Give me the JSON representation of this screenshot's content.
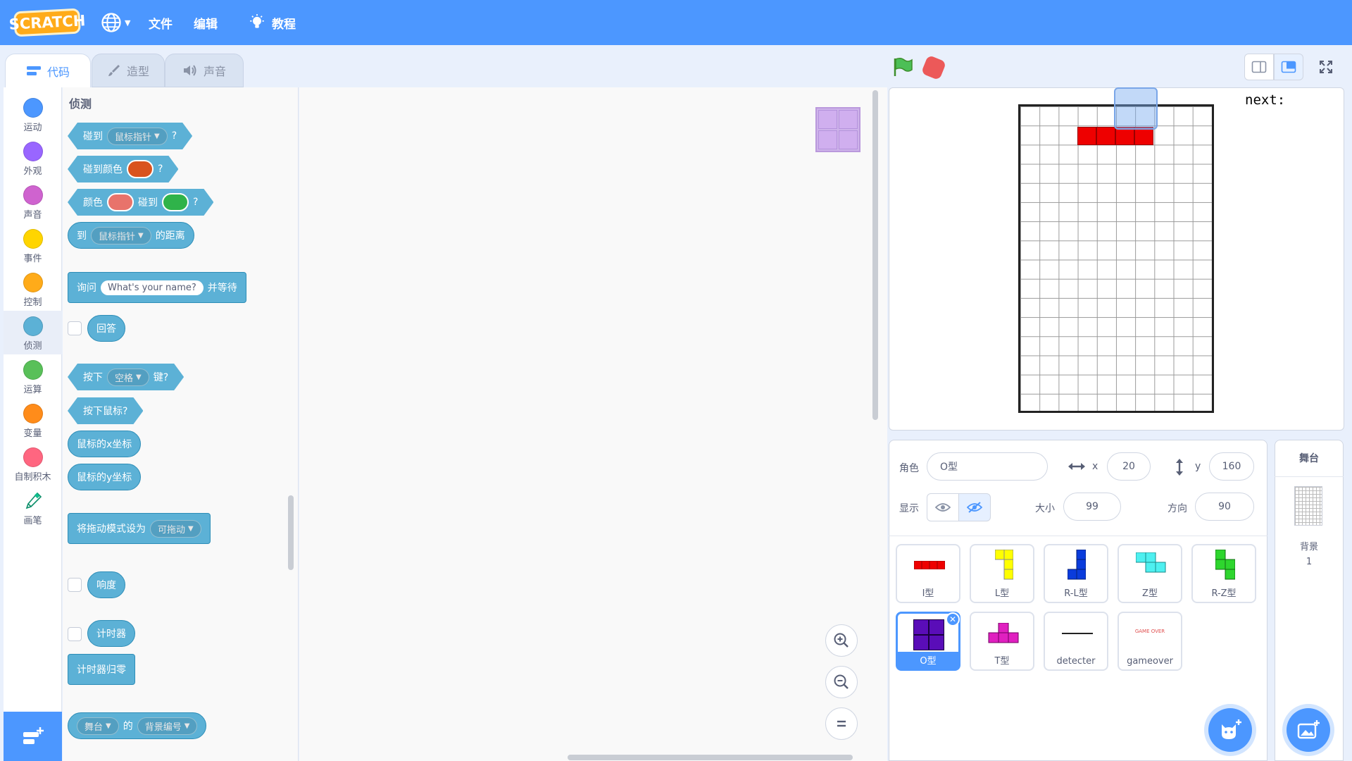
{
  "menubar": {
    "logo_text": "SCRATCH",
    "items": [
      "文件",
      "编辑"
    ],
    "tutorial_label": "教程"
  },
  "tabs": [
    {
      "label": "代码"
    },
    {
      "label": "造型"
    },
    {
      "label": "声音"
    }
  ],
  "categories": [
    {
      "label": "运动",
      "color": "#4c97ff"
    },
    {
      "label": "外观",
      "color": "#9966ff"
    },
    {
      "label": "声音",
      "color": "#cf63cf"
    },
    {
      "label": "事件",
      "color": "#ffd500"
    },
    {
      "label": "控制",
      "color": "#ffab19"
    },
    {
      "label": "侦测",
      "color": "#5cb1d6"
    },
    {
      "label": "运算",
      "color": "#59c059"
    },
    {
      "label": "变量",
      "color": "#ff8c1a"
    },
    {
      "label": "自制积木",
      "color": "#ff6680"
    },
    {
      "label": "画笔",
      "color": "#0fbd8c"
    }
  ],
  "palette": {
    "title": "侦测",
    "touching": {
      "pre": "碰到",
      "menu": "鼠标指针",
      "q": "?"
    },
    "touching_color": {
      "pre": "碰到颜色",
      "swatch": "#d9531e",
      "q": "?"
    },
    "color_touching": {
      "pre": "颜色",
      "swatch1": "#e8736b",
      "mid": "碰到",
      "swatch2": "#2fb34a",
      "q": "?"
    },
    "distance": {
      "pre": "到",
      "menu": "鼠标指针",
      "post": "的距离"
    },
    "ask": {
      "pre": "询问",
      "input": "What's your name?",
      "post": "并等待"
    },
    "answer": "回答",
    "key_pressed": {
      "pre": "按下",
      "menu": "空格",
      "post": "键?"
    },
    "mouse_down": "按下鼠标?",
    "mouse_x": "鼠标的x坐标",
    "mouse_y": "鼠标的y坐标",
    "drag_mode": {
      "pre": "将拖动模式设为",
      "menu": "可拖动"
    },
    "loudness": "响度",
    "timer": "计时器",
    "reset_timer": "计时器归零",
    "of": {
      "menu1": "舞台",
      "mid": "的",
      "menu2": "背景编号"
    }
  },
  "stage": {
    "next_label": "next:",
    "grid_color": "#9a9a9a",
    "piece_color": "#ee0000"
  },
  "sprite_info": {
    "sprite_label": "角色",
    "sprite_name": "O型",
    "x_label": "x",
    "x_value": "20",
    "y_label": "y",
    "y_value": "160",
    "show_label": "显示",
    "size_label": "大小",
    "size_value": "99",
    "direction_label": "方向",
    "direction_value": "90"
  },
  "sprites": [
    {
      "name": "I型"
    },
    {
      "name": "L型"
    },
    {
      "name": "R-L型"
    },
    {
      "name": "Z型"
    },
    {
      "name": "R-Z型"
    },
    {
      "name": "O型"
    },
    {
      "name": "T型"
    },
    {
      "name": "detecter"
    },
    {
      "name": "gameover",
      "thumb_text": "GAME OVER"
    }
  ],
  "stage_panel": {
    "title": "舞台",
    "backdrops_label": "背景",
    "backdrop_count": "1"
  }
}
